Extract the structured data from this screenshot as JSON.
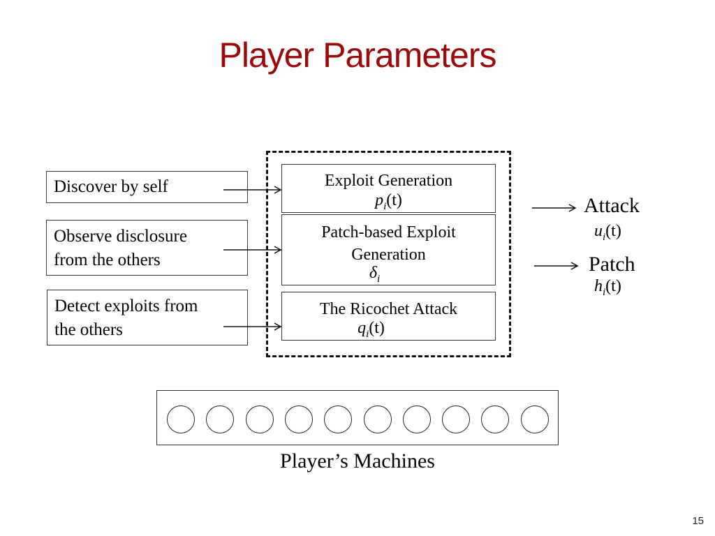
{
  "slide": {
    "title": "Player Parameters",
    "page_number": "15",
    "title_color": "#9b0a0a"
  },
  "sources": [
    {
      "lines": [
        "Discover by self"
      ]
    },
    {
      "lines": [
        "Observe disclosure",
        "from the others"
      ]
    },
    {
      "lines": [
        "Detect exploits from",
        "the others"
      ]
    }
  ],
  "processes": [
    {
      "label_lines": [
        "Exploit Generation"
      ],
      "symbol": "p",
      "subscript": "i",
      "arg": "(t)"
    },
    {
      "label_lines": [
        "Patch-based Exploit",
        "Generation"
      ],
      "symbol": "δ",
      "subscript": "i",
      "arg": ""
    },
    {
      "label_lines": [
        "The Ricochet Attack"
      ],
      "symbol": "q",
      "subscript": "i",
      "arg": "(t)"
    }
  ],
  "outputs": [
    {
      "label": "Attack",
      "symbol": "u",
      "subscript": "i",
      "arg": "(t)"
    },
    {
      "label": "Patch",
      "symbol": "h",
      "subscript": "i",
      "arg": "(t)"
    }
  ],
  "machines": {
    "count": 10,
    "caption": "Player’s Machines"
  }
}
